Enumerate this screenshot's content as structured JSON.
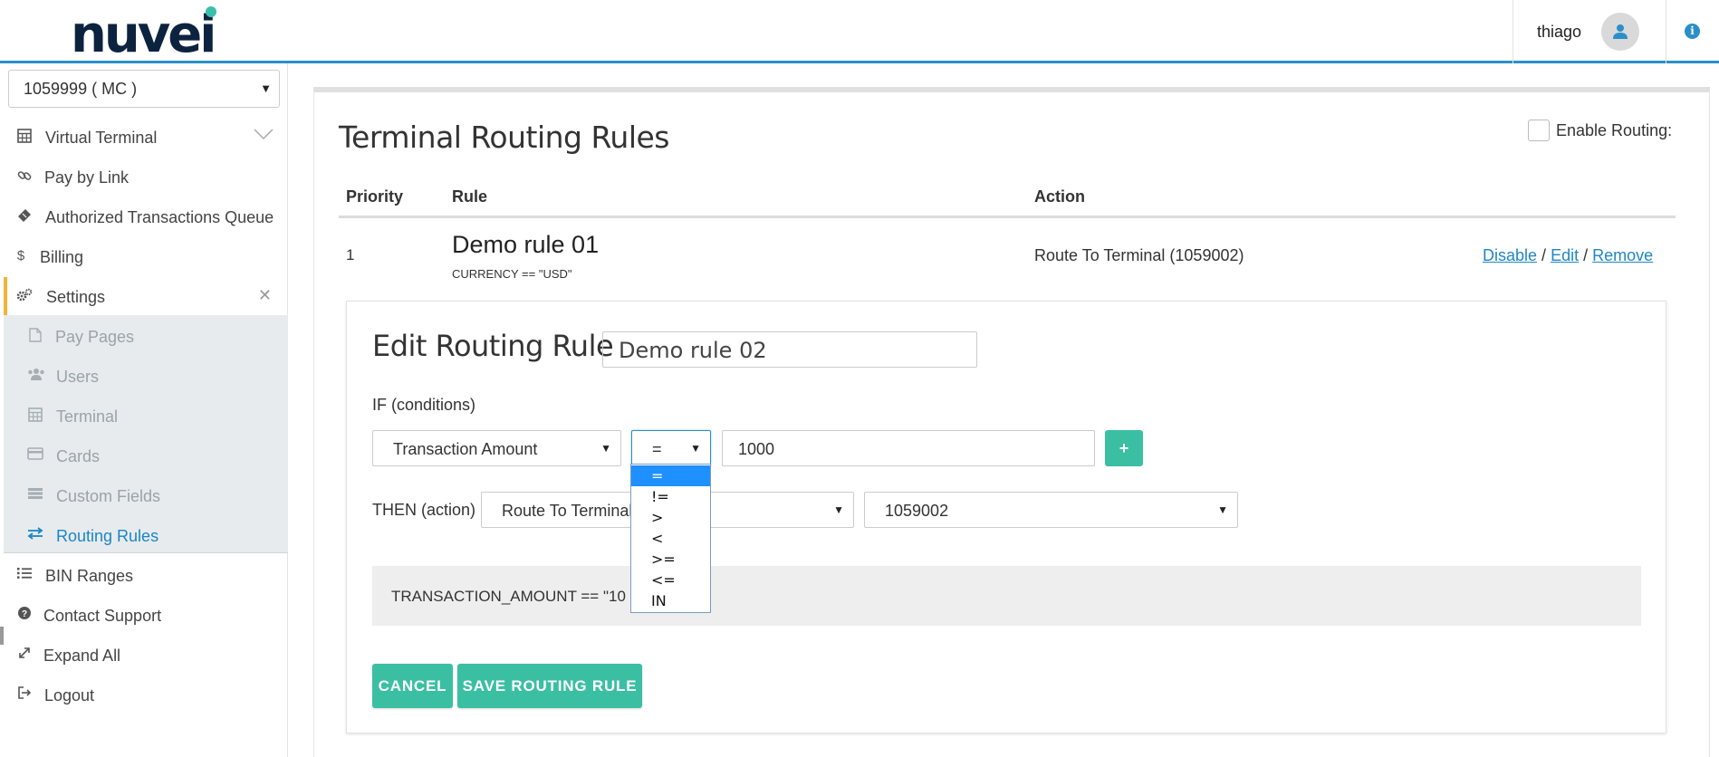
{
  "header": {
    "logo_text": "nuvei",
    "user_name": "thiago",
    "user_icon": "user-icon",
    "info_icon": "info-icon"
  },
  "sidebar": {
    "merchant_select": "1059999 ( MC )",
    "items": [
      {
        "label": "Virtual Terminal",
        "icon": "calculator-icon"
      },
      {
        "label": "Pay by Link",
        "icon": "link-icon"
      },
      {
        "label": "Authorized Transactions Queue",
        "icon": "ticket-icon"
      },
      {
        "label": "Billing",
        "icon": "dollar-icon"
      },
      {
        "label": "Settings",
        "icon": "gears-icon"
      },
      {
        "label": "BIN Ranges",
        "icon": "list-icon"
      },
      {
        "label": "Contact Support",
        "icon": "question-icon"
      },
      {
        "label": "Expand All",
        "icon": "expand-icon"
      },
      {
        "label": "Logout",
        "icon": "logout-icon"
      }
    ],
    "settings_sub": [
      {
        "label": "Pay Pages",
        "icon": "file-icon"
      },
      {
        "label": "Users",
        "icon": "users-icon"
      },
      {
        "label": "Terminal",
        "icon": "calculator-icon"
      },
      {
        "label": "Cards",
        "icon": "credit-card-icon"
      },
      {
        "label": "Custom Fields",
        "icon": "fields-icon"
      },
      {
        "label": "Routing Rules",
        "icon": "exchange-icon"
      }
    ]
  },
  "main": {
    "title": "Terminal Routing Rules",
    "enable_routing_label": "Enable Routing:",
    "table": {
      "headers": [
        "Priority",
        "Rule",
        "Action"
      ],
      "rows": [
        {
          "priority": "1",
          "rule_name": "Demo rule 01",
          "rule_condition": "CURRENCY == \"USD\"",
          "action": "Route To Terminal (1059002)",
          "links": [
            "Disable",
            "Edit",
            "Remove"
          ],
          "separator": "/"
        }
      ]
    },
    "edit": {
      "title": "Edit Routing Rule",
      "name_value": "Demo rule 02",
      "if_label": "IF (conditions)",
      "condition_field": "Transaction Amount",
      "operator": "=",
      "condition_value": "1000",
      "add_label": "+",
      "then_label": "THEN (action)",
      "action_select": "Route To Terminal",
      "terminal_select": "1059002",
      "preview": "TRANSACTION_AMOUNT == \"10",
      "cancel_label": "CANCEL",
      "save_label": "SAVE ROUTING RULE",
      "operator_options": [
        "=",
        "!=",
        ">",
        "<",
        ">=",
        "<=",
        "IN"
      ]
    }
  },
  "colors": {
    "accent": "#3bbfa3",
    "link": "#1f86c5",
    "header_rule": "#2a8fc9",
    "settings_marker": "#f5b335"
  }
}
